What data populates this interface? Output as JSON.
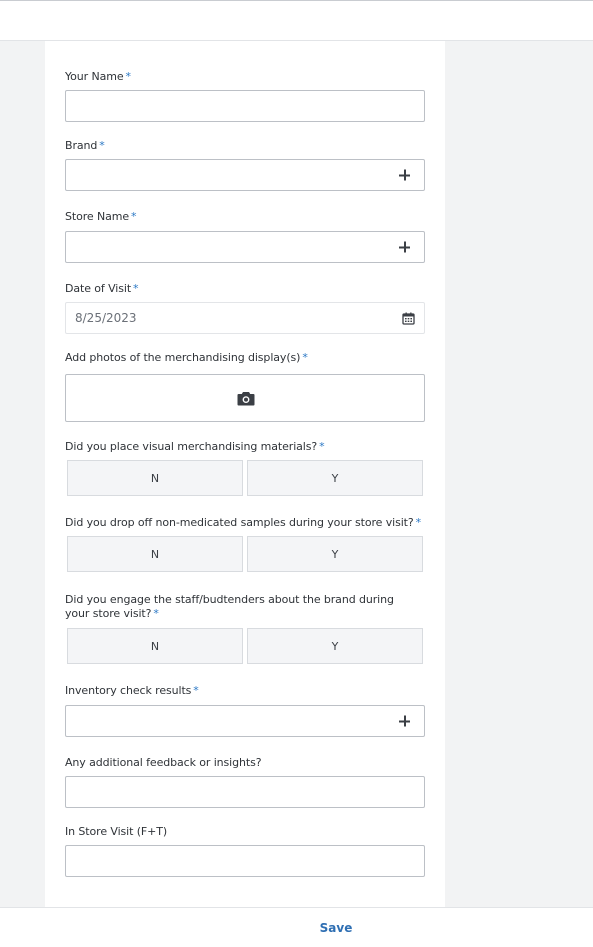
{
  "form": {
    "your_name": {
      "label": "Your Name",
      "required": "*",
      "value": ""
    },
    "brand": {
      "label": "Brand",
      "required": "*"
    },
    "store_name": {
      "label": "Store Name",
      "required": "*"
    },
    "date_of_visit": {
      "label": "Date of Visit",
      "required": "*",
      "value": "8/25/2023"
    },
    "photos": {
      "label": "Add photos of the merchandising display(s)",
      "required": "*"
    },
    "visual_materials": {
      "label": "Did you place visual merchandising materials?",
      "required": "*",
      "options": [
        "N",
        "Y"
      ]
    },
    "samples": {
      "label": "Did you drop off non-medicated samples during your store visit?",
      "required": "*",
      "options": [
        "N",
        "Y"
      ]
    },
    "engage_staff": {
      "label": "Did you engage the staff/budtenders about the brand during your store visit?",
      "required": "*",
      "options": [
        "N",
        "Y"
      ]
    },
    "inventory": {
      "label": "Inventory check results",
      "required": "*"
    },
    "feedback": {
      "label": "Any additional feedback or insights?",
      "value": ""
    },
    "in_store_visit": {
      "label": "In Store Visit (F+T)",
      "value": ""
    }
  },
  "footer": {
    "save_label": "Save"
  },
  "colors": {
    "required_marker": "#2b78c5",
    "save": "#2f6fb3",
    "page_bg": "#f2f3f4"
  },
  "icons": {
    "add": "plus-icon",
    "date": "calendar-icon",
    "photo": "camera-icon"
  }
}
